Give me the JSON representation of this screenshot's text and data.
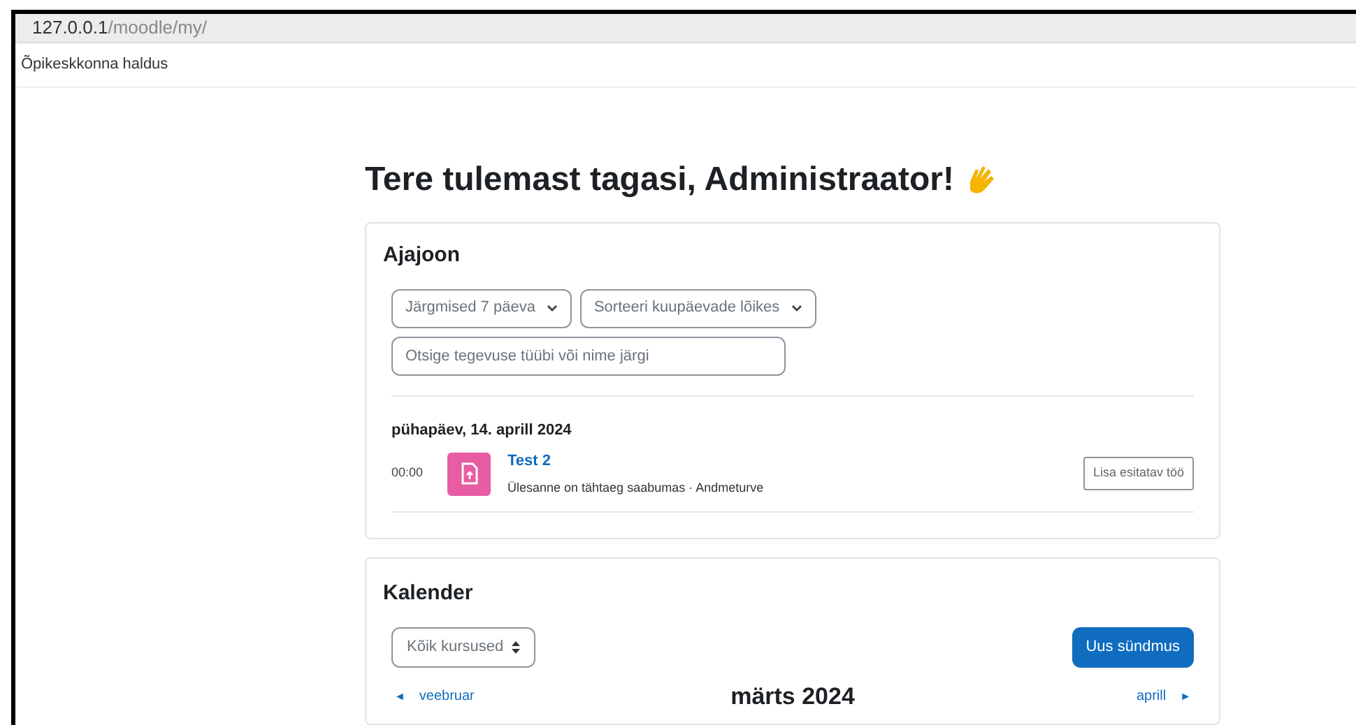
{
  "address_bar": {
    "host": "127.0.0.1",
    "path": "/moodle/my/"
  },
  "navbar": {
    "title": "Õpikeskkonna haldus"
  },
  "heading": "Tere tulemast tagasi, Administraator!",
  "timeline": {
    "title": "Ajajoon",
    "filters": [
      "Järgmised 7 päeva",
      "Sorteeri kuupäevade lõikes"
    ],
    "search": {
      "placeholder": "Otsige tegevuse tüübi või nime järgi"
    },
    "days": [
      {
        "date": "pühapäev, 14. aprill 2024",
        "events": [
          {
            "time": "00:00",
            "name": "Test 2",
            "description": "Ülesanne on tähtaeg saabumas · Andmeturve",
            "action": "Lisa esitatav töö"
          }
        ]
      }
    ]
  },
  "calendar": {
    "title": "Kalender",
    "course_select": "Kõik kursused",
    "new_event": "Uus sündmus",
    "prev_arrow": "◄",
    "prev": "veebruar",
    "month": "märts 2024",
    "next": "aprill",
    "next_arrow": "►"
  }
}
